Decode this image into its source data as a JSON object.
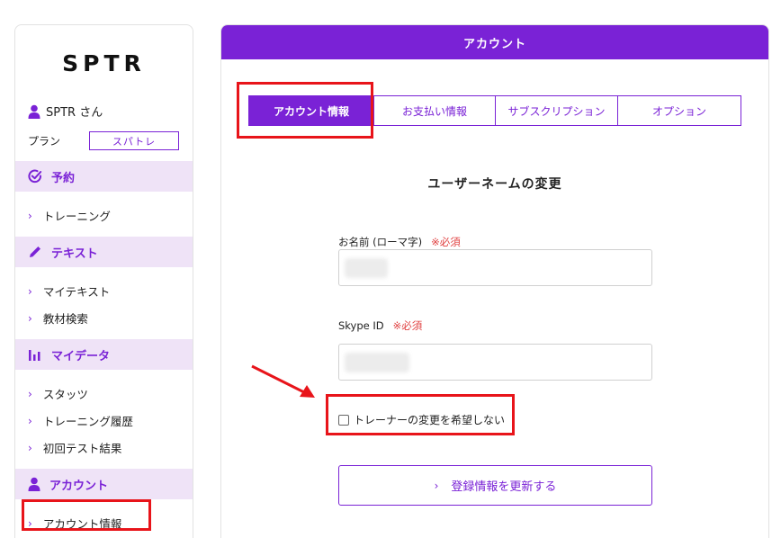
{
  "sidebar": {
    "logo": "SPTR",
    "user_name": "SPTR さん",
    "plan_label": "プラン",
    "plan_value": "スパトレ",
    "sections": [
      {
        "title": "予約",
        "icon": "check-circle-icon",
        "items": [
          "トレーニング"
        ]
      },
      {
        "title": "テキスト",
        "icon": "pencil-icon",
        "items": [
          "マイテキスト",
          "教材検索"
        ]
      },
      {
        "title": "マイデータ",
        "icon": "bar-chart-icon",
        "items": [
          "スタッツ",
          "トレーニング履歴",
          "初回テスト結果"
        ]
      },
      {
        "title": "アカウント",
        "icon": "user-icon",
        "items": [
          "アカウント情報"
        ]
      }
    ]
  },
  "main": {
    "header": "アカウント",
    "tabs": [
      "アカウント情報",
      "お支払い情報",
      "サブスクリプション",
      "オプション"
    ],
    "active_tab": "アカウント情報",
    "section_title": "ユーザーネームの変更",
    "fields": [
      {
        "label": "お名前 (ローマ字)",
        "required": "※必須"
      },
      {
        "label": "Skype ID",
        "required": "※必須"
      }
    ],
    "checkbox_label": "トレーナーの変更を希望しない",
    "submit_label": "登録情報を更新する"
  },
  "colors": {
    "accent": "#7a22d6",
    "highlight": "#efe3f7",
    "annotation": "#e8141a",
    "required": "#e04040"
  }
}
